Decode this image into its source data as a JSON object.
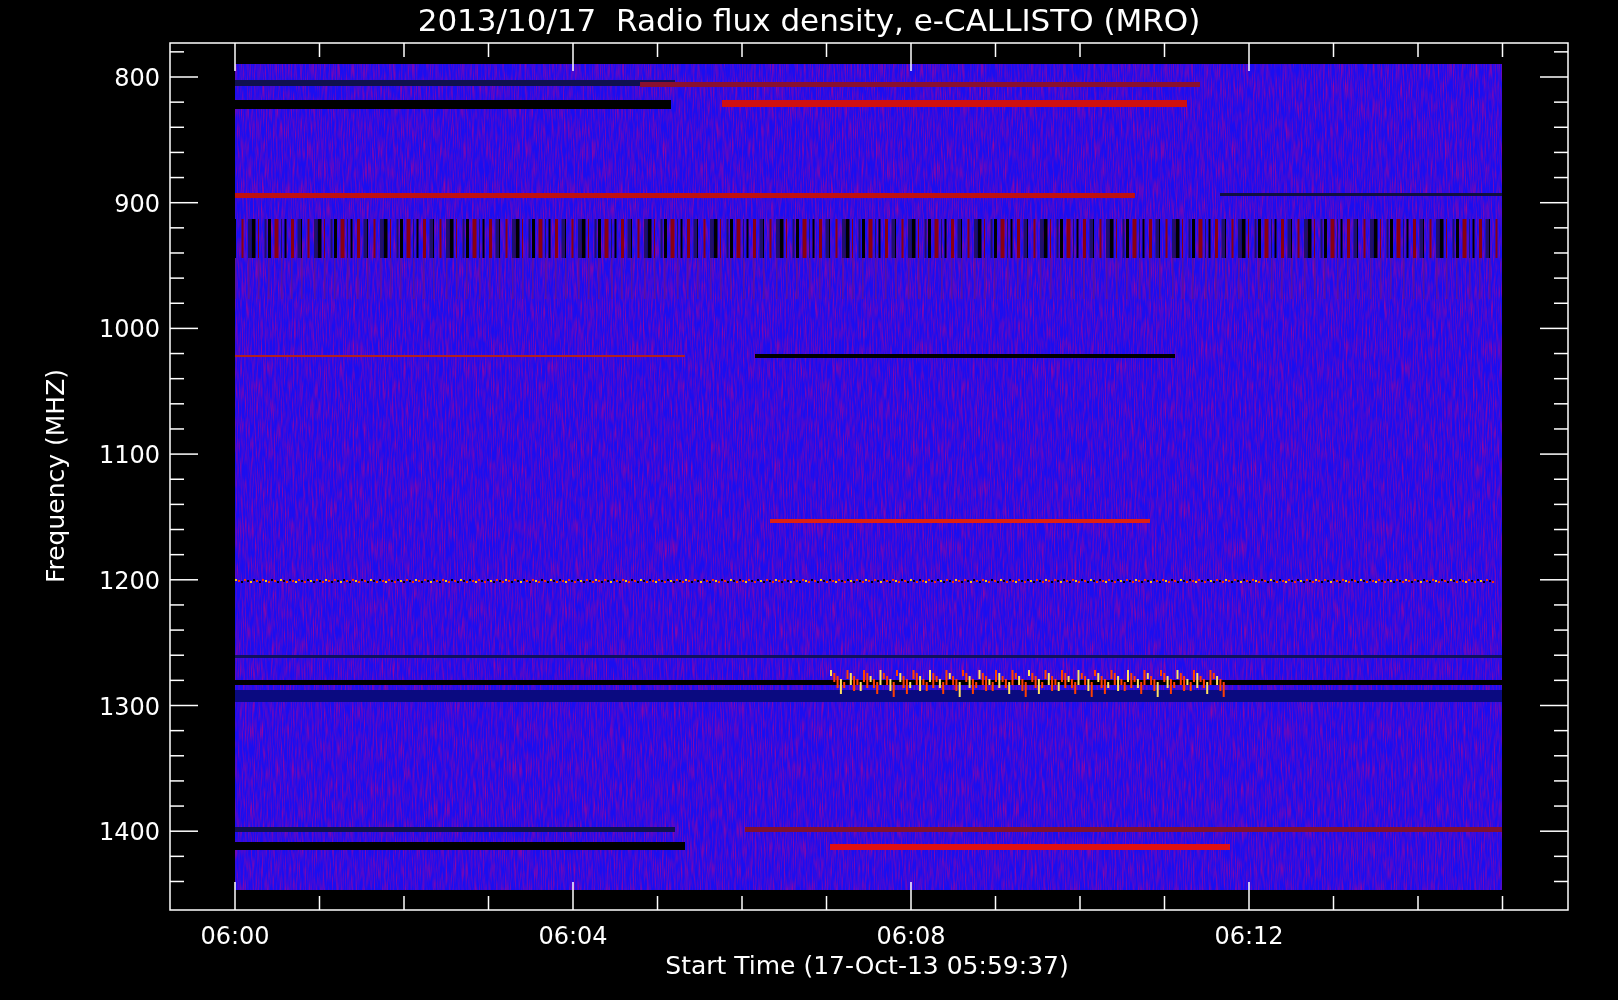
{
  "title": "2013/10/17  Radio flux density, e-CALLISTO (MRO)",
  "y_axis": {
    "label": "Frequency (MHZ)",
    "ticks": [
      "800",
      "900",
      "1000",
      "1100",
      "1200",
      "1300",
      "1400"
    ]
  },
  "x_axis": {
    "label": "Start Time (17-Oct-13 05:59:37)",
    "ticks": [
      "06:00",
      "06:04",
      "06:08",
      "06:12"
    ]
  }
}
